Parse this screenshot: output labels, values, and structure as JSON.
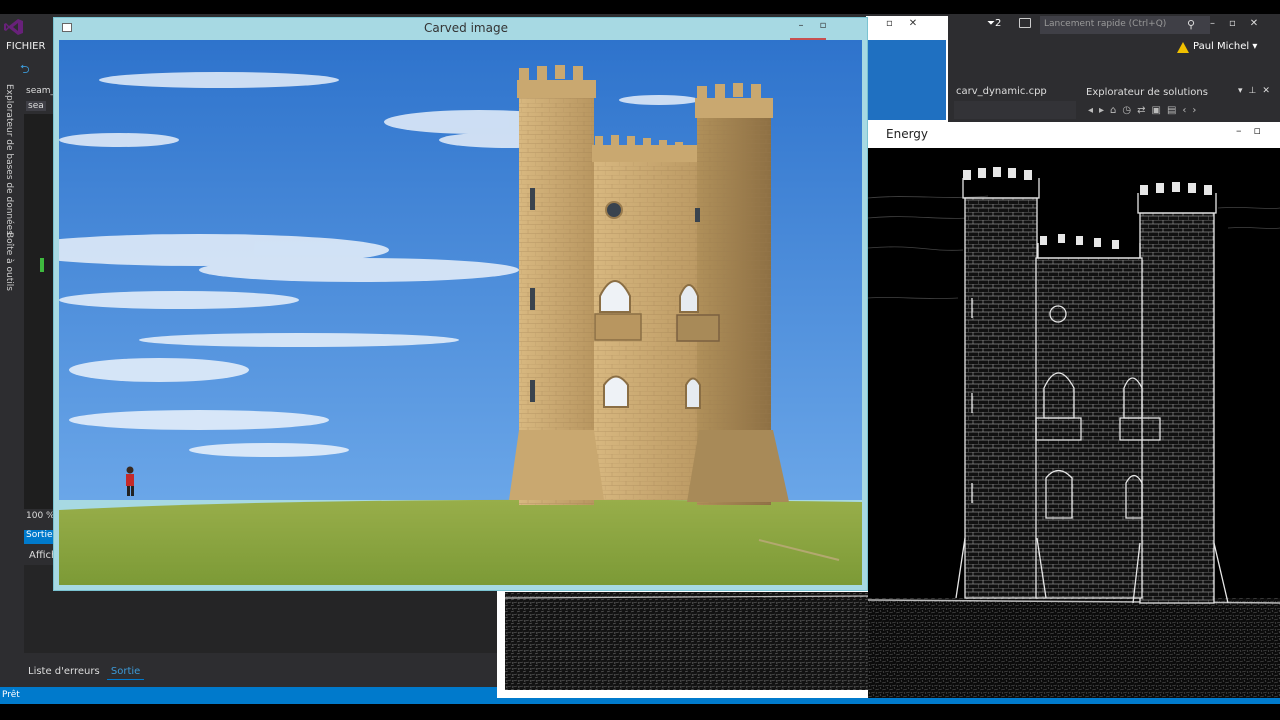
{
  "vs": {
    "menu_fichier": "FICHIER",
    "tab_short": "sea",
    "proj_short": "seam_",
    "proj_short2": "sea",
    "vertical_tab_1": "Explorateur de bases de données",
    "vertical_tab_2": "Boîte à outils",
    "zoom": "100 %",
    "sortie_tab": "Sortie",
    "afficher_label": "Affich",
    "bottom_tabs": [
      "Liste d'erreurs",
      "Sortie"
    ],
    "status": "Prêt",
    "filter_count": "2",
    "quick_launch_placeholder": "Lancement rapide (Ctrl+Q)",
    "user_name": "Paul Michel",
    "file_tab": "carv_dynamic.cpp",
    "solution_explorer_title": "Explorateur de solutions"
  },
  "windows": {
    "carved": {
      "title": "Carved image"
    },
    "energy": {
      "title": "Energy"
    }
  },
  "colors": {
    "vs_bg": "#2d2d30",
    "vs_blue": "#007acc",
    "sky": "#3b82d6",
    "grass": "#8aa640",
    "stone": "#c9a870",
    "close_red": "#c75050"
  },
  "icons": {
    "vs_logo": "vs-logo-icon",
    "back": "back-arrow-icon",
    "filter": "filter-icon",
    "feedback": "feedback-icon",
    "search": "search-icon",
    "warning": "warning-icon"
  }
}
